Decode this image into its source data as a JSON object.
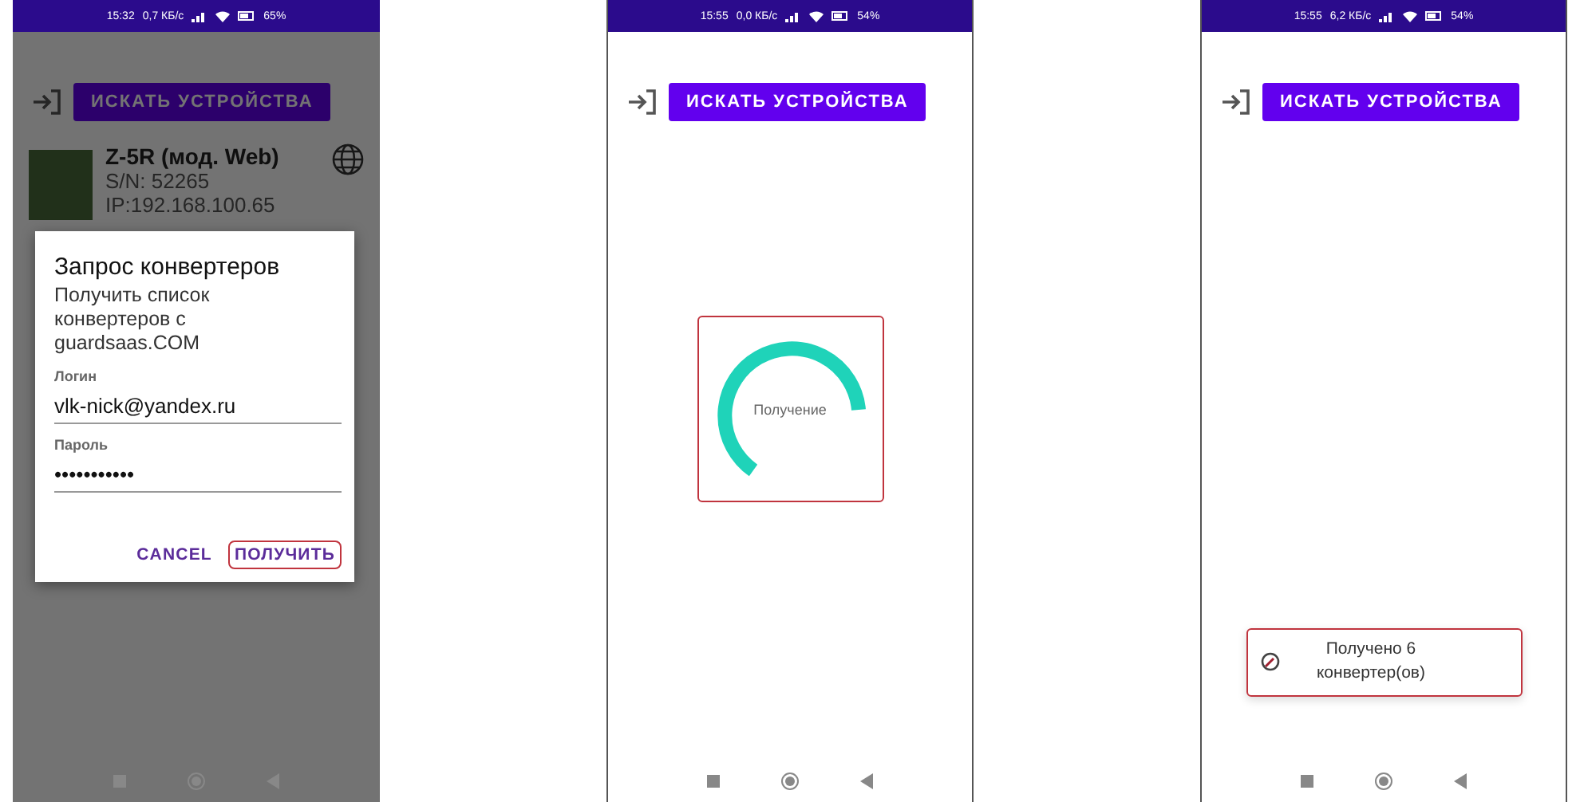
{
  "screens": [
    {
      "kind": "dialog",
      "status": {
        "time": "15:32",
        "speed": "0,7 КБ/с",
        "battery": "65%"
      },
      "search_button": "ИСКАТЬ УСТРОЙСТВА",
      "device": {
        "name": "Z-5R (мод. Web)",
        "serial": "S/N: 52265",
        "ip": "IP:192.168.100.65"
      },
      "dialog": {
        "title": "Запрос конвертеров",
        "message": "Получить список конвертеров с guardsaas.COM",
        "fields": [
          {
            "label": "Логин",
            "value": "vlk-nick@yandex.ru"
          },
          {
            "label": "Пароль",
            "value": "•••••••••••"
          }
        ],
        "buttons": [
          {
            "label": "CANCEL",
            "highlighted": false
          },
          {
            "label": "ПОЛУЧИТЬ",
            "highlighted": true
          }
        ]
      }
    },
    {
      "kind": "progress",
      "status": {
        "time": "15:55",
        "speed": "0,0 КБ/с",
        "battery": "54%"
      },
      "search_button": "ИСКАТЬ УСТРОЙСТВА",
      "progress": {
        "label": "Получение",
        "highlighted": true
      }
    },
    {
      "kind": "toast",
      "status": {
        "time": "15:55",
        "speed": "6,2 КБ/с",
        "battery": "54%"
      },
      "search_button": "ИСКАТЬ УСТРОЙСТВА",
      "toast": {
        "text": "Получено 6 конвертер(ов)",
        "highlighted": true
      }
    }
  ]
}
